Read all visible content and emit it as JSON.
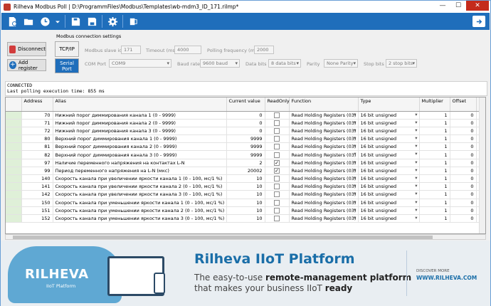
{
  "window": {
    "title": "Rilheva Modbus Poll | D:\\ProgrammFiles\\Modbus\\Templates\\wb-mdm3_ID_171.rilmp*",
    "minimize": "—",
    "maximize": "☐",
    "close": "✕"
  },
  "toolbar": {
    "icons": [
      "new-file-icon",
      "open-folder-icon",
      "clock-icon",
      "dropdown-arrow-icon",
      "save-icon",
      "save-as-icon",
      "settings-icon",
      "export-icon"
    ]
  },
  "connection": {
    "disconnect_label": "Disconnect",
    "add_register_label": "Add register",
    "group_label": "Modbus connection settings",
    "tcpip_label": "TCP/IP",
    "serial_label": "Serial Port",
    "slave_id_label": "Modbus slave id",
    "slave_id": "171",
    "timeout_label": "Timeout (ms)",
    "timeout": "4000",
    "polling_label": "Polling frequency (ms)",
    "polling": "2000",
    "com_port_label": "COM Port",
    "com_port": "COM9",
    "baud_label": "Baud rate",
    "baud": "9600 baud",
    "data_bits_label": "Data bits",
    "data_bits": "8 data bits",
    "parity_label": "Parity",
    "parity": "None Parity",
    "stop_bits_label": "Stop bits",
    "stop_bits": "2 stop bits"
  },
  "console": {
    "line1": "CONNECTED",
    "line2": "Last polling execution time: 855 ms"
  },
  "table": {
    "headers": [
      "Address",
      "Alias",
      "Current value",
      "ReadOnly",
      "Function",
      "Type",
      "Multiplier",
      "Offset",
      "De pla"
    ],
    "rows": [
      {
        "address": "70",
        "alias": "Нижний порог диммирования канала 1 (0 - 9999)",
        "value": "0",
        "readonly": false,
        "function": "Read Holding Registers (03)",
        "type": "16 bit unsigned",
        "multiplier": "1",
        "offset": "0"
      },
      {
        "address": "71",
        "alias": "Нижний порог диммирования канала 2 (0 - 9999)",
        "value": "0",
        "readonly": false,
        "function": "Read Holding Registers (03)",
        "type": "16 bit unsigned",
        "multiplier": "1",
        "offset": "0"
      },
      {
        "address": "72",
        "alias": "Нижний порог диммирования канала 3 (0 - 9999)",
        "value": "0",
        "readonly": false,
        "function": "Read Holding Registers (03)",
        "type": "16 bit unsigned",
        "multiplier": "1",
        "offset": "0"
      },
      {
        "address": "80",
        "alias": "Верхний порог диммирования канала 1 (0 - 9999)",
        "value": "9999",
        "readonly": false,
        "function": "Read Holding Registers (03)",
        "type": "16 bit unsigned",
        "multiplier": "1",
        "offset": "0"
      },
      {
        "address": "81",
        "alias": "Верхний порог диммирования канала 2 (0 - 9999)",
        "value": "9999",
        "readonly": false,
        "function": "Read Holding Registers (03)",
        "type": "16 bit unsigned",
        "multiplier": "1",
        "offset": "0"
      },
      {
        "address": "82",
        "alias": "Верхний порог диммирования канала 3 (0 - 9999)",
        "value": "9999",
        "readonly": false,
        "function": "Read Holding Registers (03)",
        "type": "16 bit unsigned",
        "multiplier": "1",
        "offset": "0"
      },
      {
        "address": "97",
        "alias": "Наличие переменного напряжения на контактах L-N",
        "value": "2",
        "readonly": true,
        "function": "Read Holding Registers (03)",
        "type": "16 bit unsigned",
        "multiplier": "1",
        "offset": "0"
      },
      {
        "address": "99",
        "alias": "Период переменного напряжения на L-N (мкс)",
        "value": "20002",
        "readonly": true,
        "function": "Read Holding Registers (03)",
        "type": "16 bit unsigned",
        "multiplier": "1",
        "offset": "0"
      },
      {
        "address": "140",
        "alias": "Скорость канала при увеличении яркости канала 1 (0 - 100, мс/1 %)",
        "value": "10",
        "readonly": false,
        "function": "Read Holding Registers (03)",
        "type": "16 bit unsigned",
        "multiplier": "1",
        "offset": "0"
      },
      {
        "address": "141",
        "alias": "Скорость канала при увеличении яркости канала 2 (0 - 100, мс/1 %)",
        "value": "10",
        "readonly": false,
        "function": "Read Holding Registers (03)",
        "type": "16 bit unsigned",
        "multiplier": "1",
        "offset": "0"
      },
      {
        "address": "142",
        "alias": "Скорость канала при увеличении яркости канала 3 (0 - 100, мс/1 %)",
        "value": "10",
        "readonly": false,
        "function": "Read Holding Registers (03)",
        "type": "16 bit unsigned",
        "multiplier": "1",
        "offset": "0"
      },
      {
        "address": "150",
        "alias": "Скорость канала при уменьшении яркости канала 1 (0 - 100, мс/1 %)",
        "value": "10",
        "readonly": false,
        "function": "Read Holding Registers (03)",
        "type": "16 bit unsigned",
        "multiplier": "1",
        "offset": "0"
      },
      {
        "address": "151",
        "alias": "Скорость канала при уменьшении яркости канала 2 (0 - 100, мс/1 %)",
        "value": "10",
        "readonly": false,
        "function": "Read Holding Registers (03)",
        "type": "16 bit unsigned",
        "multiplier": "1",
        "offset": "0"
      },
      {
        "address": "152",
        "alias": "Скорость канала при уменьшении яркости канала 3 (0 - 100, мс/1 %)",
        "value": "10",
        "readonly": false,
        "function": "Read Holding Registers (03)",
        "type": "16 bit unsigned",
        "multiplier": "1",
        "offset": "0"
      }
    ]
  },
  "banner": {
    "logo": "RILHEVA",
    "logo_sub": "IIoT Platform",
    "headline": "Rilheva IIoT Platform",
    "line1_a": "The easy-to-use ",
    "line1_b": "remote-management platform",
    "line2_a": "that makes your business IIoT ",
    "line2_b": "ready",
    "discover": "DISCOVER MORE",
    "url": "WWW.RILHEVA.COM"
  },
  "colors": {
    "toolbar": "#1f6ebb",
    "row_marker": "#dff0d8",
    "banner_accent": "#1a6ea8"
  }
}
